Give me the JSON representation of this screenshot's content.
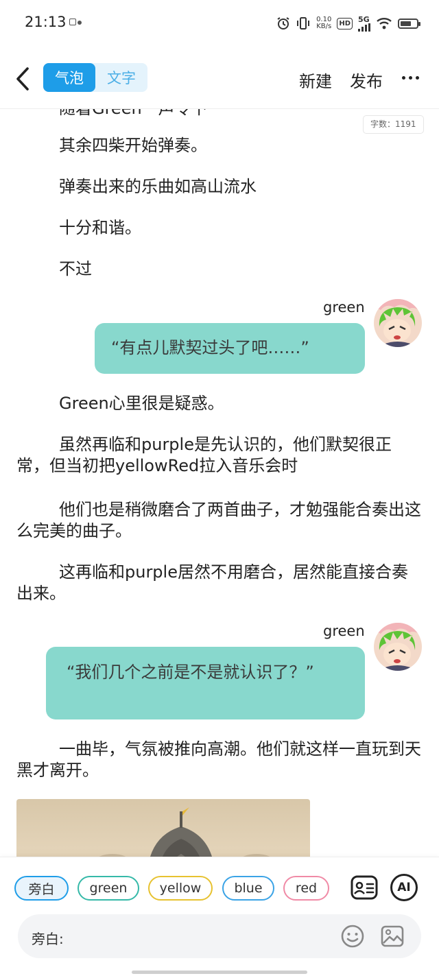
{
  "status_bar": {
    "time": "21:13",
    "speed_value": "0.10",
    "speed_unit": "KB/s",
    "hd_badge": "HD",
    "network": "5G",
    "battery_level": 0.7
  },
  "top_bar": {
    "tab_bubble": "气泡",
    "tab_text": "文字",
    "new_label": "新建",
    "publish_label": "发布"
  },
  "word_count": "字数：1191",
  "story": {
    "clipped_line": "随着Green一声令下",
    "paragraphs": [
      "其余四柴开始弹奏。",
      "弹奏出来的乐曲如高山流水",
      "十分和谐。",
      "不过",
      "Green心里很是疑惑。",
      "虽然再临和purple是先认识的，他们默契很正常，但当初把yellowRed拉入音乐会时",
      "他们也是稍微磨合了两首曲子，才勉强能合奏出这么完美的曲子。",
      "这再临和purple居然不用磨合，居然能直接合奏出来。",
      "一曲毕，气氛被推向高潮。他们就这样一直玩到天黑才离开。"
    ],
    "dialogues": [
      {
        "speaker": "green",
        "text": "“有点儿默契过头了吧……”"
      },
      {
        "speaker": "green",
        "text": "“我们几个之前是不是就认识了？”"
      }
    ]
  },
  "role_chips": [
    {
      "label": "旁白",
      "color": "#1e9de8"
    },
    {
      "label": "green",
      "color": "#35b9a8"
    },
    {
      "label": "yellow",
      "color": "#e7c230"
    },
    {
      "label": "blue",
      "color": "#3aa3e6"
    },
    {
      "label": "red",
      "color": "#f08aa6"
    }
  ],
  "toolbar_icons": {
    "character_card": "character-card-icon",
    "ai": "AI"
  },
  "input": {
    "label": "旁白:"
  },
  "colors": {
    "accent": "#1e9de8",
    "bubble": "#88d8cd"
  }
}
